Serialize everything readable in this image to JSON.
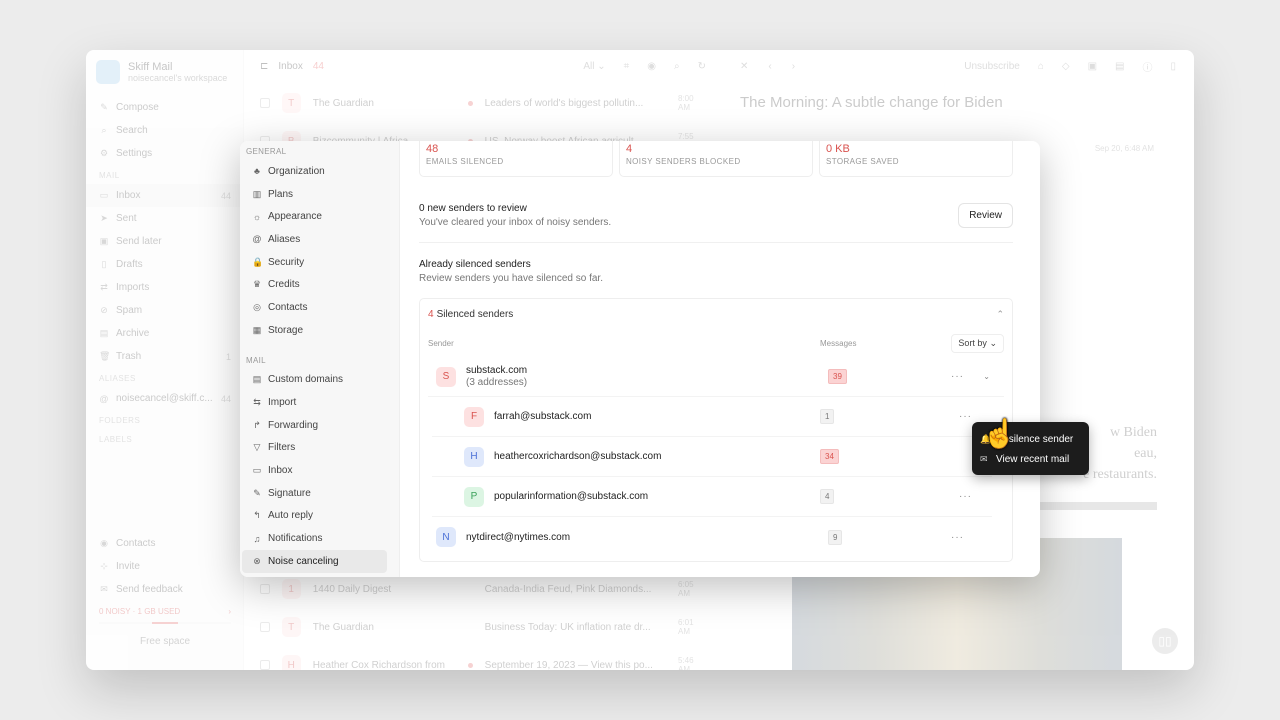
{
  "app": {
    "brand_name": "Skiff Mail",
    "workspace": "noisecancel's workspace",
    "nav_top": [
      {
        "icon": "compose-icon",
        "glyph": "✎",
        "label": "Compose"
      },
      {
        "icon": "search-icon",
        "glyph": "⌕",
        "label": "Search"
      },
      {
        "icon": "gear-icon",
        "glyph": "⚙",
        "label": "Settings"
      }
    ],
    "mail_section": "MAIL",
    "mail_items": [
      {
        "icon": "inbox-icon",
        "glyph": "▭",
        "label": "Inbox",
        "count": "44"
      },
      {
        "icon": "sent-icon",
        "glyph": "➤",
        "label": "Sent",
        "count": ""
      },
      {
        "icon": "send-later-icon",
        "glyph": "▣",
        "label": "Send later",
        "count": ""
      },
      {
        "icon": "drafts-icon",
        "glyph": "▯",
        "label": "Drafts",
        "count": ""
      },
      {
        "icon": "imports-icon",
        "glyph": "⇄",
        "label": "Imports",
        "count": ""
      },
      {
        "icon": "spam-icon",
        "glyph": "⊘",
        "label": "Spam",
        "count": ""
      },
      {
        "icon": "archive-icon",
        "glyph": "▤",
        "label": "Archive",
        "count": ""
      },
      {
        "icon": "trash-icon",
        "glyph": "🗑",
        "label": "Trash",
        "count": "1"
      }
    ],
    "aliases_section": "ALIASES",
    "alias": {
      "icon": "at-icon",
      "glyph": "@",
      "label": "noisecancel@skiff.c...",
      "count": "44"
    },
    "folders_section": "FOLDERS",
    "labels_section": "LABELS",
    "nav_bottom": [
      {
        "icon": "contacts-icon",
        "glyph": "◉",
        "label": "Contacts"
      },
      {
        "icon": "invite-icon",
        "glyph": "⊹",
        "label": "Invite"
      },
      {
        "icon": "feedback-icon",
        "glyph": "✉",
        "label": "Send feedback"
      }
    ],
    "storage_text": "0 NOISY · 1 GB USED",
    "storage_fraction": 0.4,
    "free_space_label": "Free space"
  },
  "inbox": {
    "title": "Inbox",
    "count": "44",
    "filter": "All",
    "rows_top": [
      {
        "avatar": "T",
        "from": "The Guardian",
        "subject": "Leaders of world's biggest pollutin...",
        "time": "8:00 AM",
        "unread": true
      },
      {
        "avatar": "B",
        "from": "Bizcommunity | Africa",
        "subject": "US, Norway boost African agricult...",
        "time": "7:55 AM",
        "unread": true
      }
    ],
    "rows_bottom": [
      {
        "avatar": "1",
        "from": "1440 Daily Digest",
        "subject": "Canada-India Feud, Pink Diamonds...",
        "time": "6:05 AM",
        "unread": false
      },
      {
        "avatar": "T",
        "from": "The Guardian",
        "subject": "Business Today: UK inflation rate dr...",
        "time": "6:01 AM",
        "unread": false
      },
      {
        "avatar": "H",
        "from": "Heather Cox Richardson from",
        "subject": "September 19, 2023 — View this po...",
        "time": "5:46 AM",
        "unread": true
      }
    ]
  },
  "reader": {
    "unsubscribe_label": "Unsubscribe",
    "title": "The Morning: A subtle change for Biden",
    "date": "Sep 20, 6:48 AM",
    "body_lines": [
      "w Biden",
      "eau,",
      "e restaurants."
    ]
  },
  "settings": {
    "general_section": "GENERAL",
    "general_items": [
      {
        "icon": "organization-icon",
        "glyph": "♣",
        "label": "Organization"
      },
      {
        "icon": "plans-icon",
        "glyph": "▥",
        "label": "Plans"
      },
      {
        "icon": "appearance-icon",
        "glyph": "☼",
        "label": "Appearance"
      },
      {
        "icon": "at-icon",
        "glyph": "@",
        "label": "Aliases"
      },
      {
        "icon": "lock-icon",
        "glyph": "🔒",
        "label": "Security"
      },
      {
        "icon": "trophy-icon",
        "glyph": "♛",
        "label": "Credits"
      },
      {
        "icon": "contacts-icon",
        "glyph": "◎",
        "label": "Contacts"
      },
      {
        "icon": "storage-icon",
        "glyph": "▦",
        "label": "Storage"
      }
    ],
    "mail_section": "MAIL",
    "mail_items": [
      {
        "icon": "custom-domains-icon",
        "glyph": "▤",
        "label": "Custom domains"
      },
      {
        "icon": "import-icon",
        "glyph": "⇆",
        "label": "Import"
      },
      {
        "icon": "forwarding-icon",
        "glyph": "↱",
        "label": "Forwarding"
      },
      {
        "icon": "filter-icon",
        "glyph": "▽",
        "label": "Filters"
      },
      {
        "icon": "inbox-icon",
        "glyph": "▭",
        "label": "Inbox"
      },
      {
        "icon": "pen-icon",
        "glyph": "✎",
        "label": "Signature"
      },
      {
        "icon": "reply-icon",
        "glyph": "↰",
        "label": "Auto reply"
      },
      {
        "icon": "bell-icon",
        "glyph": "♫",
        "label": "Notifications"
      },
      {
        "icon": "noise-cancel-icon",
        "glyph": "⊗",
        "label": "Noise canceling",
        "active": true
      }
    ],
    "stats": [
      {
        "value": "48",
        "label": "EMAILS SILENCED"
      },
      {
        "value": "4",
        "label": "NOISY SENDERS BLOCKED"
      },
      {
        "value": "0 KB",
        "label": "STORAGE SAVED"
      }
    ],
    "review": {
      "title": "0 new senders to review",
      "desc": "You've cleared your inbox of noisy senders.",
      "button": "Review"
    },
    "silenced": {
      "title": "Already silenced senders",
      "desc": "Review senders you have silenced so far.",
      "count": "4",
      "box_title": "Silenced senders",
      "col_sender": "Sender",
      "col_messages": "Messages",
      "sort_label": "Sort by",
      "group": {
        "avatar": "S",
        "name": "substack.com",
        "sub": "(3 addresses)",
        "count": "39"
      },
      "children": [
        {
          "avatar": "F",
          "color": "red",
          "email": "farrah@substack.com",
          "count": "1",
          "hot": false
        },
        {
          "avatar": "H",
          "color": "blue",
          "email": "heathercoxrichardson@substack.com",
          "count": "34",
          "hot": true
        },
        {
          "avatar": "P",
          "color": "green",
          "email": "popularinformation@substack.com",
          "count": "4",
          "hot": false
        }
      ],
      "single": {
        "avatar": "N",
        "color": "blue",
        "email": "nytdirect@nytimes.com",
        "count": "9"
      }
    },
    "context_menu": [
      {
        "icon": "unsilence-icon",
        "glyph": "🔔",
        "label": "Unsilence sender"
      },
      {
        "icon": "mail-icon",
        "glyph": "✉",
        "label": "View recent mail"
      }
    ]
  }
}
